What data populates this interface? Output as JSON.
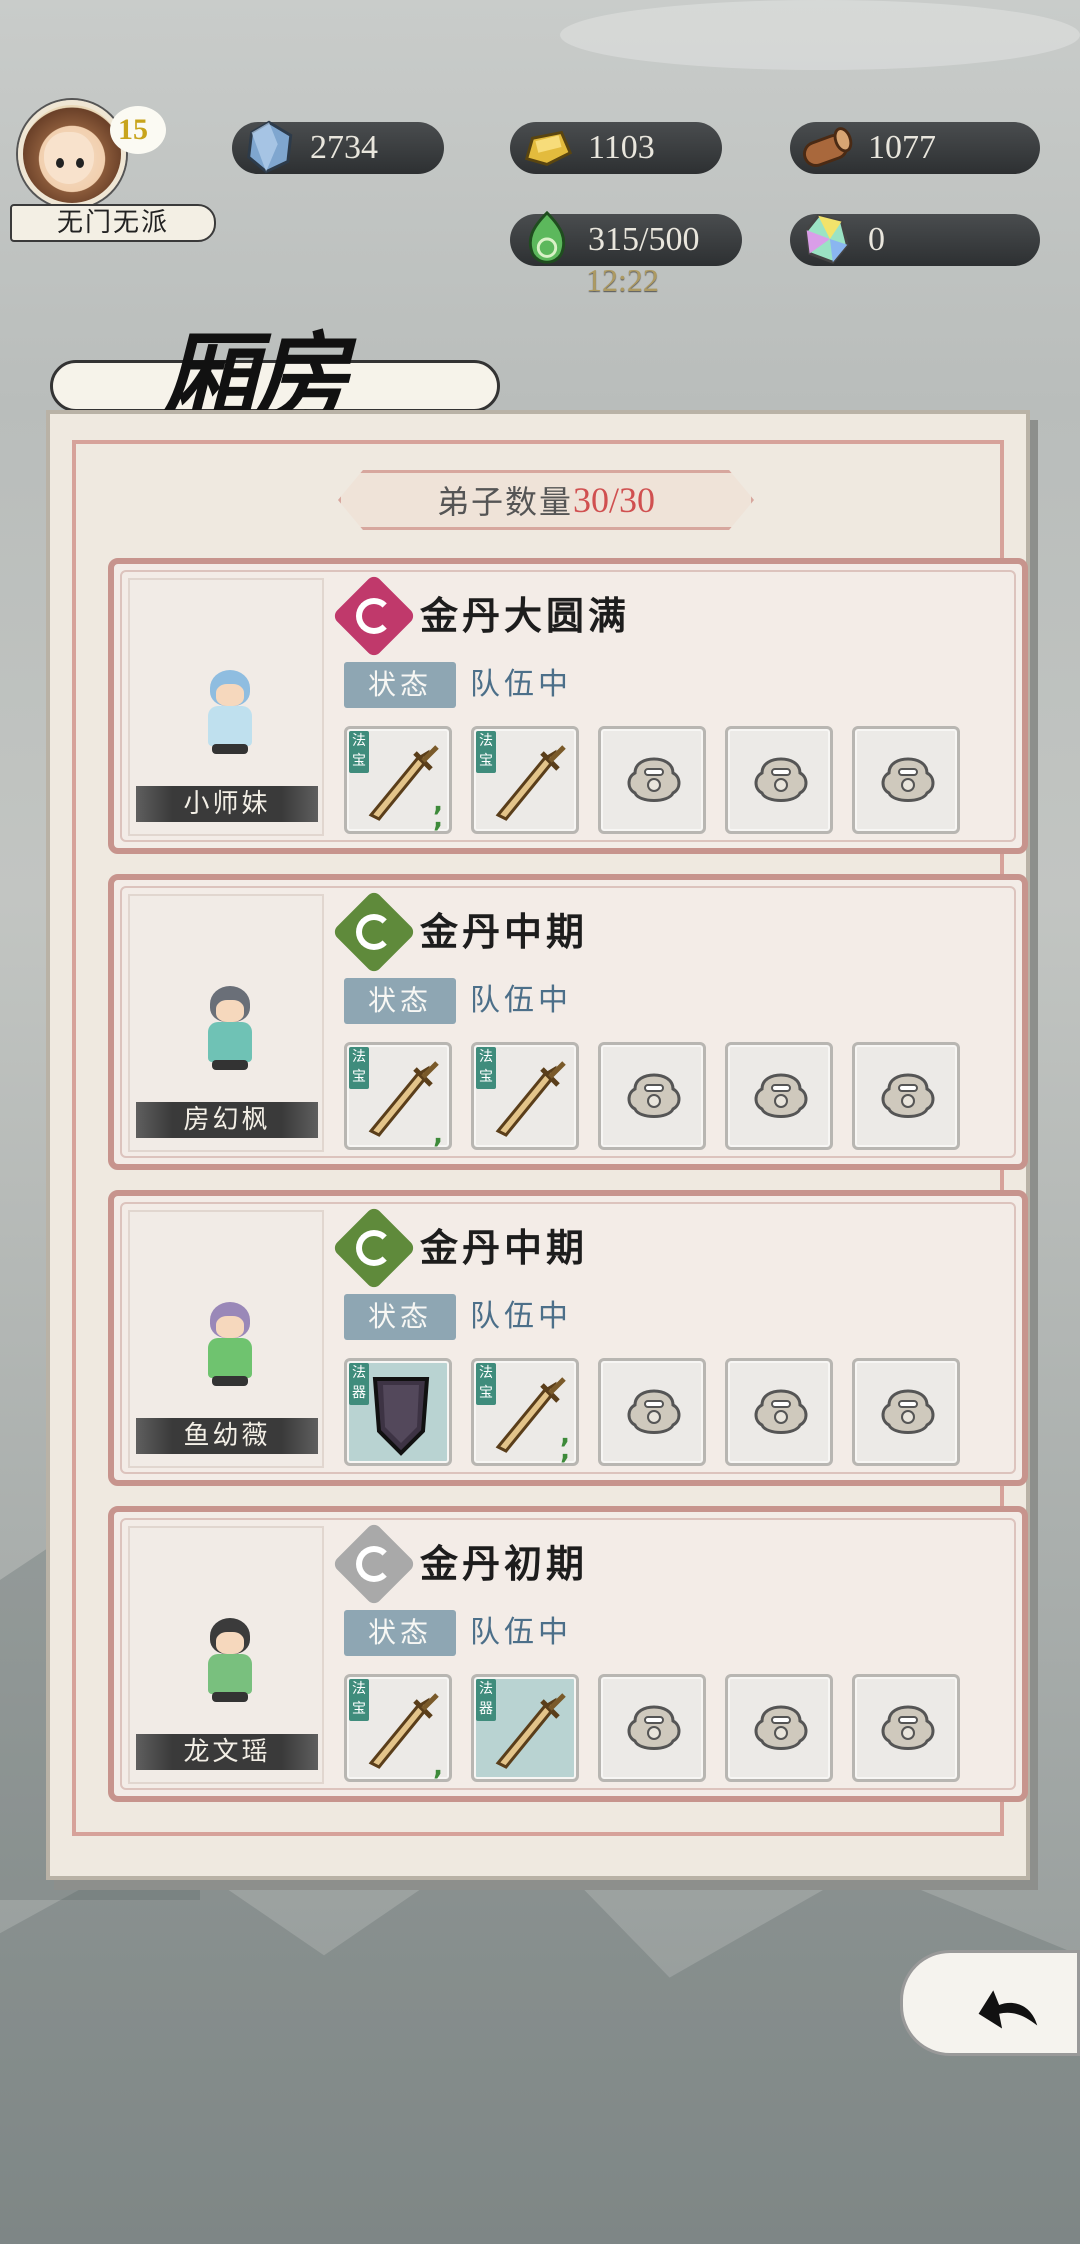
{
  "player": {
    "level": "15",
    "sect": "无门无派"
  },
  "resources": {
    "stone": "2734",
    "gold": "1103",
    "wood": "1077",
    "stamina": "315/500",
    "crystal": "0",
    "timer": "12:22"
  },
  "page": {
    "title": "厢房"
  },
  "disciples_header": {
    "label": "弟子数量",
    "value": "30/30"
  },
  "cards": [
    {
      "name": "小师妹",
      "realm": "金丹大圆满",
      "status_label": "状态",
      "status_value": "队伍中",
      "realm_color": "#c0396b",
      "slots": [
        {
          "kind": "weapon",
          "tag": "法宝",
          "dots": "2"
        },
        {
          "kind": "weapon",
          "tag": "法宝",
          "dots": ""
        },
        {
          "kind": "locked"
        },
        {
          "kind": "locked"
        },
        {
          "kind": "locked"
        }
      ]
    },
    {
      "name": "房幻枫",
      "realm": "金丹中期",
      "status_label": "状态",
      "status_value": "队伍中",
      "realm_color": "#5f8a3b",
      "slots": [
        {
          "kind": "weapon",
          "tag": "法宝",
          "dots": "1"
        },
        {
          "kind": "weapon",
          "tag": "法宝",
          "dots": ""
        },
        {
          "kind": "locked"
        },
        {
          "kind": "locked"
        },
        {
          "kind": "locked"
        }
      ]
    },
    {
      "name": "鱼幼薇",
      "realm": "金丹中期",
      "status_label": "状态",
      "status_value": "队伍中",
      "realm_color": "#5f8a3b",
      "slots": [
        {
          "kind": "armor",
          "tag": "法器",
          "dots": ""
        },
        {
          "kind": "weapon",
          "tag": "法宝",
          "dots": "2"
        },
        {
          "kind": "locked"
        },
        {
          "kind": "locked"
        },
        {
          "kind": "locked"
        }
      ]
    },
    {
      "name": "龙文瑶",
      "realm": "金丹初期",
      "status_label": "状态",
      "status_value": "队伍中",
      "realm_color": "#a9a9a9",
      "slots": [
        {
          "kind": "weapon",
          "tag": "法宝",
          "dots": "1"
        },
        {
          "kind": "weapon",
          "tag": "法器",
          "dots": ""
        },
        {
          "kind": "locked"
        },
        {
          "kind": "locked"
        },
        {
          "kind": "locked"
        }
      ]
    }
  ],
  "icons": {
    "stone": "blue-stone-icon",
    "gold": "gold-ingot-icon",
    "wood": "wood-log-icon",
    "stamina": "green-jade-icon",
    "crystal": "rainbow-crystal-icon",
    "back": "back-arrow-icon"
  },
  "colors": {
    "card_border": "#c7948d",
    "status_tag": "#8ea6b3",
    "count_highlight": "#d05050"
  }
}
